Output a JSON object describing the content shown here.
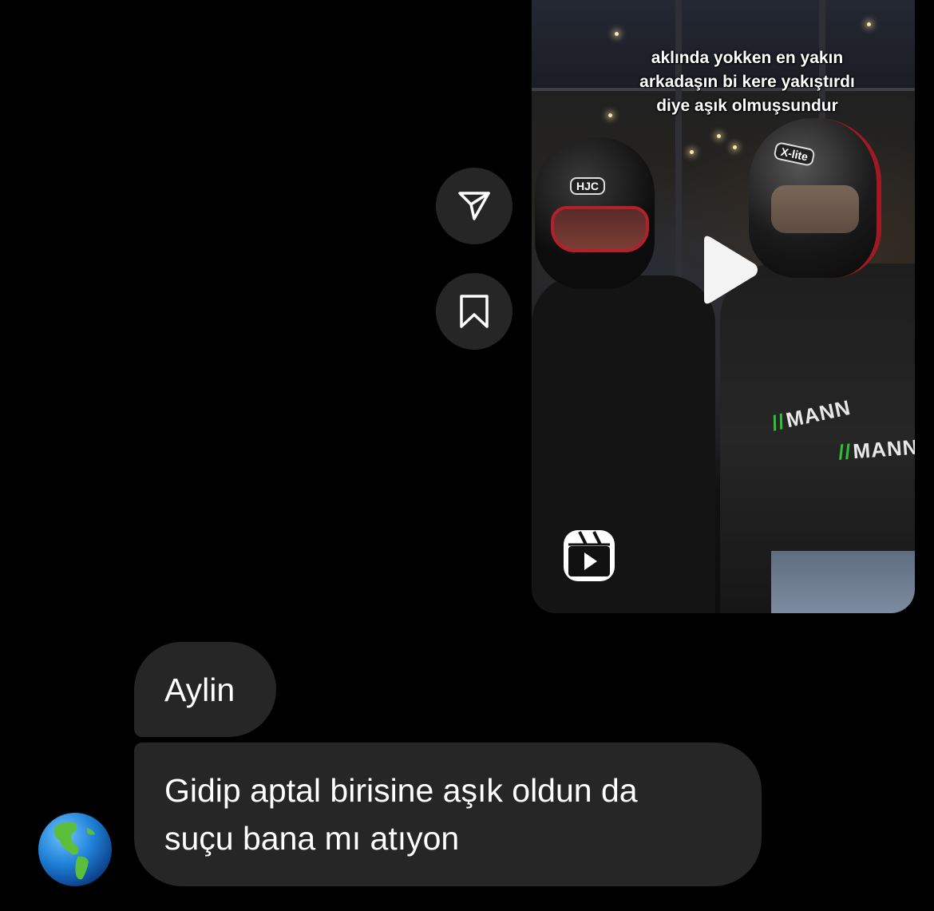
{
  "reel": {
    "caption": "aklında yokken en yakın\narkadaşın bi kere yakıştırdı\ndiye aşık olmuşsundur",
    "helmet_left_brand": "HJC",
    "helmet_right_brand": "X-lite",
    "jacket_brand_1": "MANN",
    "jacket_brand_2": "MANN",
    "stripe_1": "//",
    "stripe_2": "//"
  },
  "actions": {
    "share_icon": "paper-plane-icon",
    "save_icon": "bookmark-icon"
  },
  "messages": [
    {
      "text": "Aylin"
    },
    {
      "text": "Gidip aptal birisine aşık oldun da\nsuçu bana mı atıyon"
    }
  ],
  "avatar": {
    "icon": "globe-americas-icon"
  },
  "colors": {
    "background": "#000000",
    "bubble": "#262626",
    "text": "#ffffff",
    "helmet_accent": "#b3202a",
    "brand_green": "#2fbf3a"
  }
}
